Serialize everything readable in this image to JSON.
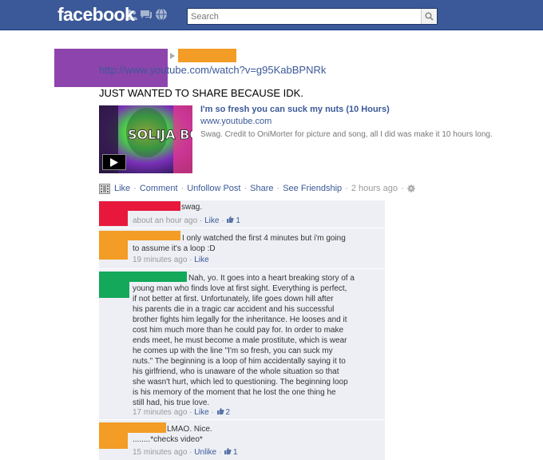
{
  "header": {
    "logo": "facebook",
    "search_placeholder": "Search",
    "icons": [
      "friends-icon",
      "messages-icon",
      "notifications-icon",
      "search-icon"
    ]
  },
  "colors": {
    "brand_blue": "#3b5998",
    "comment_bg": "#edeff4",
    "redact_purple": "#8e44ad",
    "redact_orange": "#f39c26",
    "redact_red": "#e8183c",
    "redact_green": "#14a85a"
  },
  "story": {
    "link": "http://www.youtube.com/watch?v=g95KabBPNRk",
    "text": "JUST WANTED TO SHARE BECAUSE IDK.",
    "attachment": {
      "title": "I'm so fresh you can suck my nuts (10 Hours)",
      "url": "www.youtube.com",
      "description": "Swag. Credit to OniMorter for picture and song, all I did was make it 10 hours long.",
      "thumb_text": "SOLIJA BOY"
    }
  },
  "actions": {
    "like": "Like",
    "comment": "Comment",
    "unfollow": "Unfollow Post",
    "share": "Share",
    "see_friendship": "See Friendship",
    "time": "2 hours ago"
  },
  "comments": [
    {
      "text": "swag.",
      "time": "about an hour ago",
      "action": "Like",
      "likes": "1"
    },
    {
      "lines": [
        "I only watched the first 4 minutes but i'm going",
        "to assume it's a loop :D"
      ],
      "time": "19 minutes ago",
      "action": "Like"
    },
    {
      "lines": [
        "Nah, yo. It goes into a heart breaking story of a",
        "young man who finds love at first sight. Everything is perfect,",
        "if not better at first. Unfortunately, life goes down hill after",
        "his parents die in a tragic car accident and his successful",
        "brother fights him legally for the inheritance. He looses and it",
        "cost him much more than he could pay for. In order to make",
        "ends meet, he must become a male prostitute, which is wear",
        "he comes up with the line \"I'm so fresh, you can suck my",
        "nuts.\" The beginning is a loop of him accidentally saying it to",
        "his girlfriend, who is unaware of the whole situation so that",
        "she wasn't hurt, which led to questioning. The beginning loop",
        "is his memory of the moment that he lost the one thing he",
        "still had, his true love."
      ],
      "time": "17 minutes ago",
      "action": "Like",
      "likes": "2"
    },
    {
      "lines": [
        "LMAO. Nice.",
        "........*checks video*"
      ],
      "time": "15 minutes ago",
      "action": "Unlike",
      "likes": "1"
    }
  ]
}
